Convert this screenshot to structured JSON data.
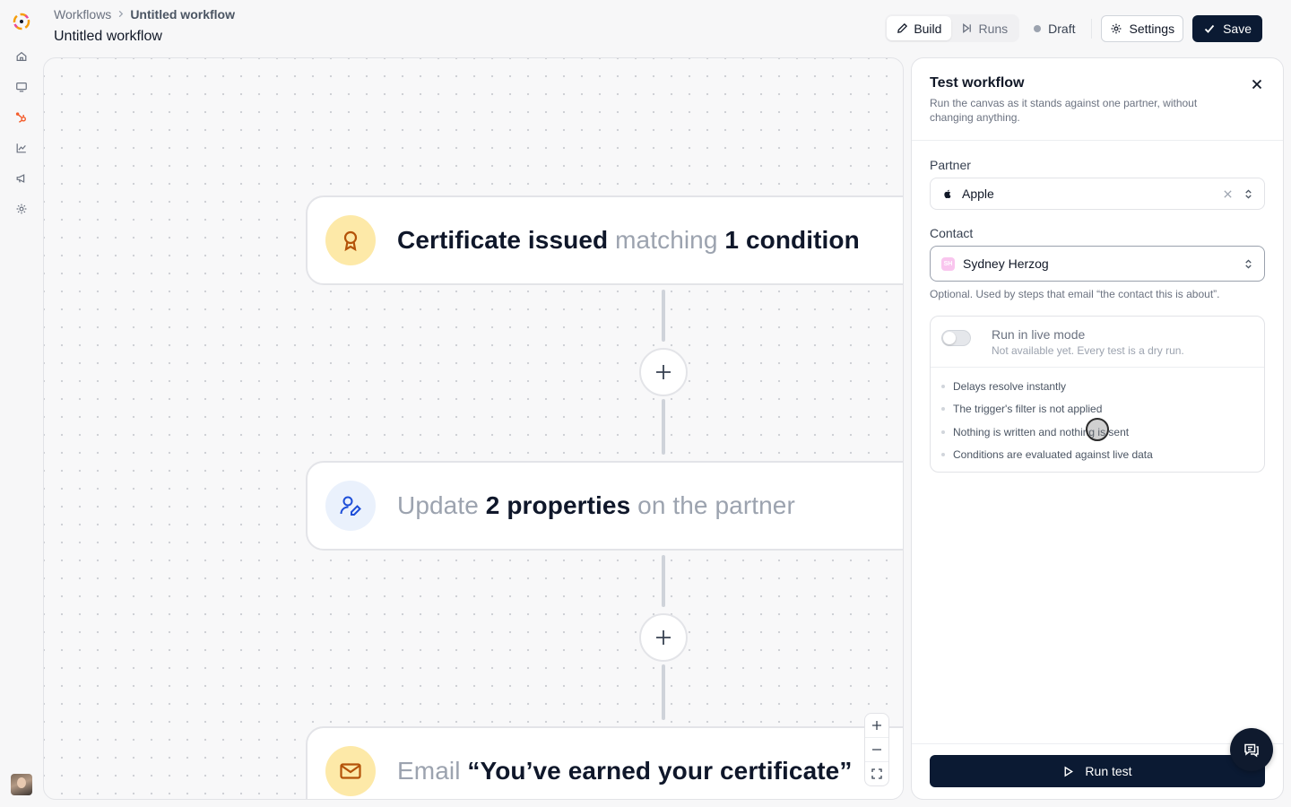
{
  "header": {
    "breadcrumb_root": "Workflows",
    "breadcrumb_current": "Untitled workflow",
    "title": "Untitled workflow",
    "tabs": [
      {
        "label": "Build",
        "icon": "pencil-icon",
        "active": true
      },
      {
        "label": "Runs",
        "icon": "step-forward-icon",
        "active": false
      }
    ],
    "status": "Draft",
    "settings_label": "Settings",
    "save_label": "Save"
  },
  "sidebar": {
    "items": [
      {
        "name": "home-icon"
      },
      {
        "name": "monitor-icon"
      },
      {
        "name": "hubspot-icon",
        "active": true
      },
      {
        "name": "chart-icon"
      },
      {
        "name": "megaphone-icon"
      },
      {
        "name": "gear-icon"
      }
    ]
  },
  "canvas": {
    "nodes": [
      {
        "icon": "award-icon",
        "icon_bg": "#fde9a8",
        "parts": [
          {
            "text": "Certificate issued",
            "style": "strong"
          },
          {
            "text": " matching ",
            "style": "muted"
          },
          {
            "text": "1 condition",
            "style": "strong"
          }
        ]
      },
      {
        "icon": "user-edit-icon",
        "icon_bg": "#eaf1fc",
        "parts": [
          {
            "text": "Update ",
            "style": "muted"
          },
          {
            "text": "2 properties",
            "style": "strong"
          },
          {
            "text": " on the partner",
            "style": "muted"
          }
        ]
      },
      {
        "icon": "mail-icon",
        "icon_bg": "#fde9a8",
        "parts": [
          {
            "text": "Email ",
            "style": "muted"
          },
          {
            "text": "“You’ve earned your certificate”",
            "style": "strong"
          }
        ]
      }
    ]
  },
  "panel": {
    "title": "Test workflow",
    "description": "Run the canvas as it stands against one partner, without changing anything.",
    "partner_label": "Partner",
    "partner_value": "Apple",
    "contact_label": "Contact",
    "contact_initials": "SH",
    "contact_value": "Sydney Herzog",
    "contact_helper": "Optional. Used by steps that email “the contact this is about”.",
    "live_title": "Run in live mode",
    "live_subtitle": "Not available yet. Every test is a dry run.",
    "live_enabled": false,
    "dry_run_notes": [
      "Delays resolve instantly",
      "The trigger's filter is not applied",
      "Nothing is written and nothing is sent",
      "Conditions are evaluated against live data"
    ],
    "run_label": "Run test"
  },
  "colors": {
    "primary": "#0b1a33",
    "accent": "#f45d2c",
    "trigger_icon": "#b45309",
    "update_icon": "#1d4ed8"
  }
}
